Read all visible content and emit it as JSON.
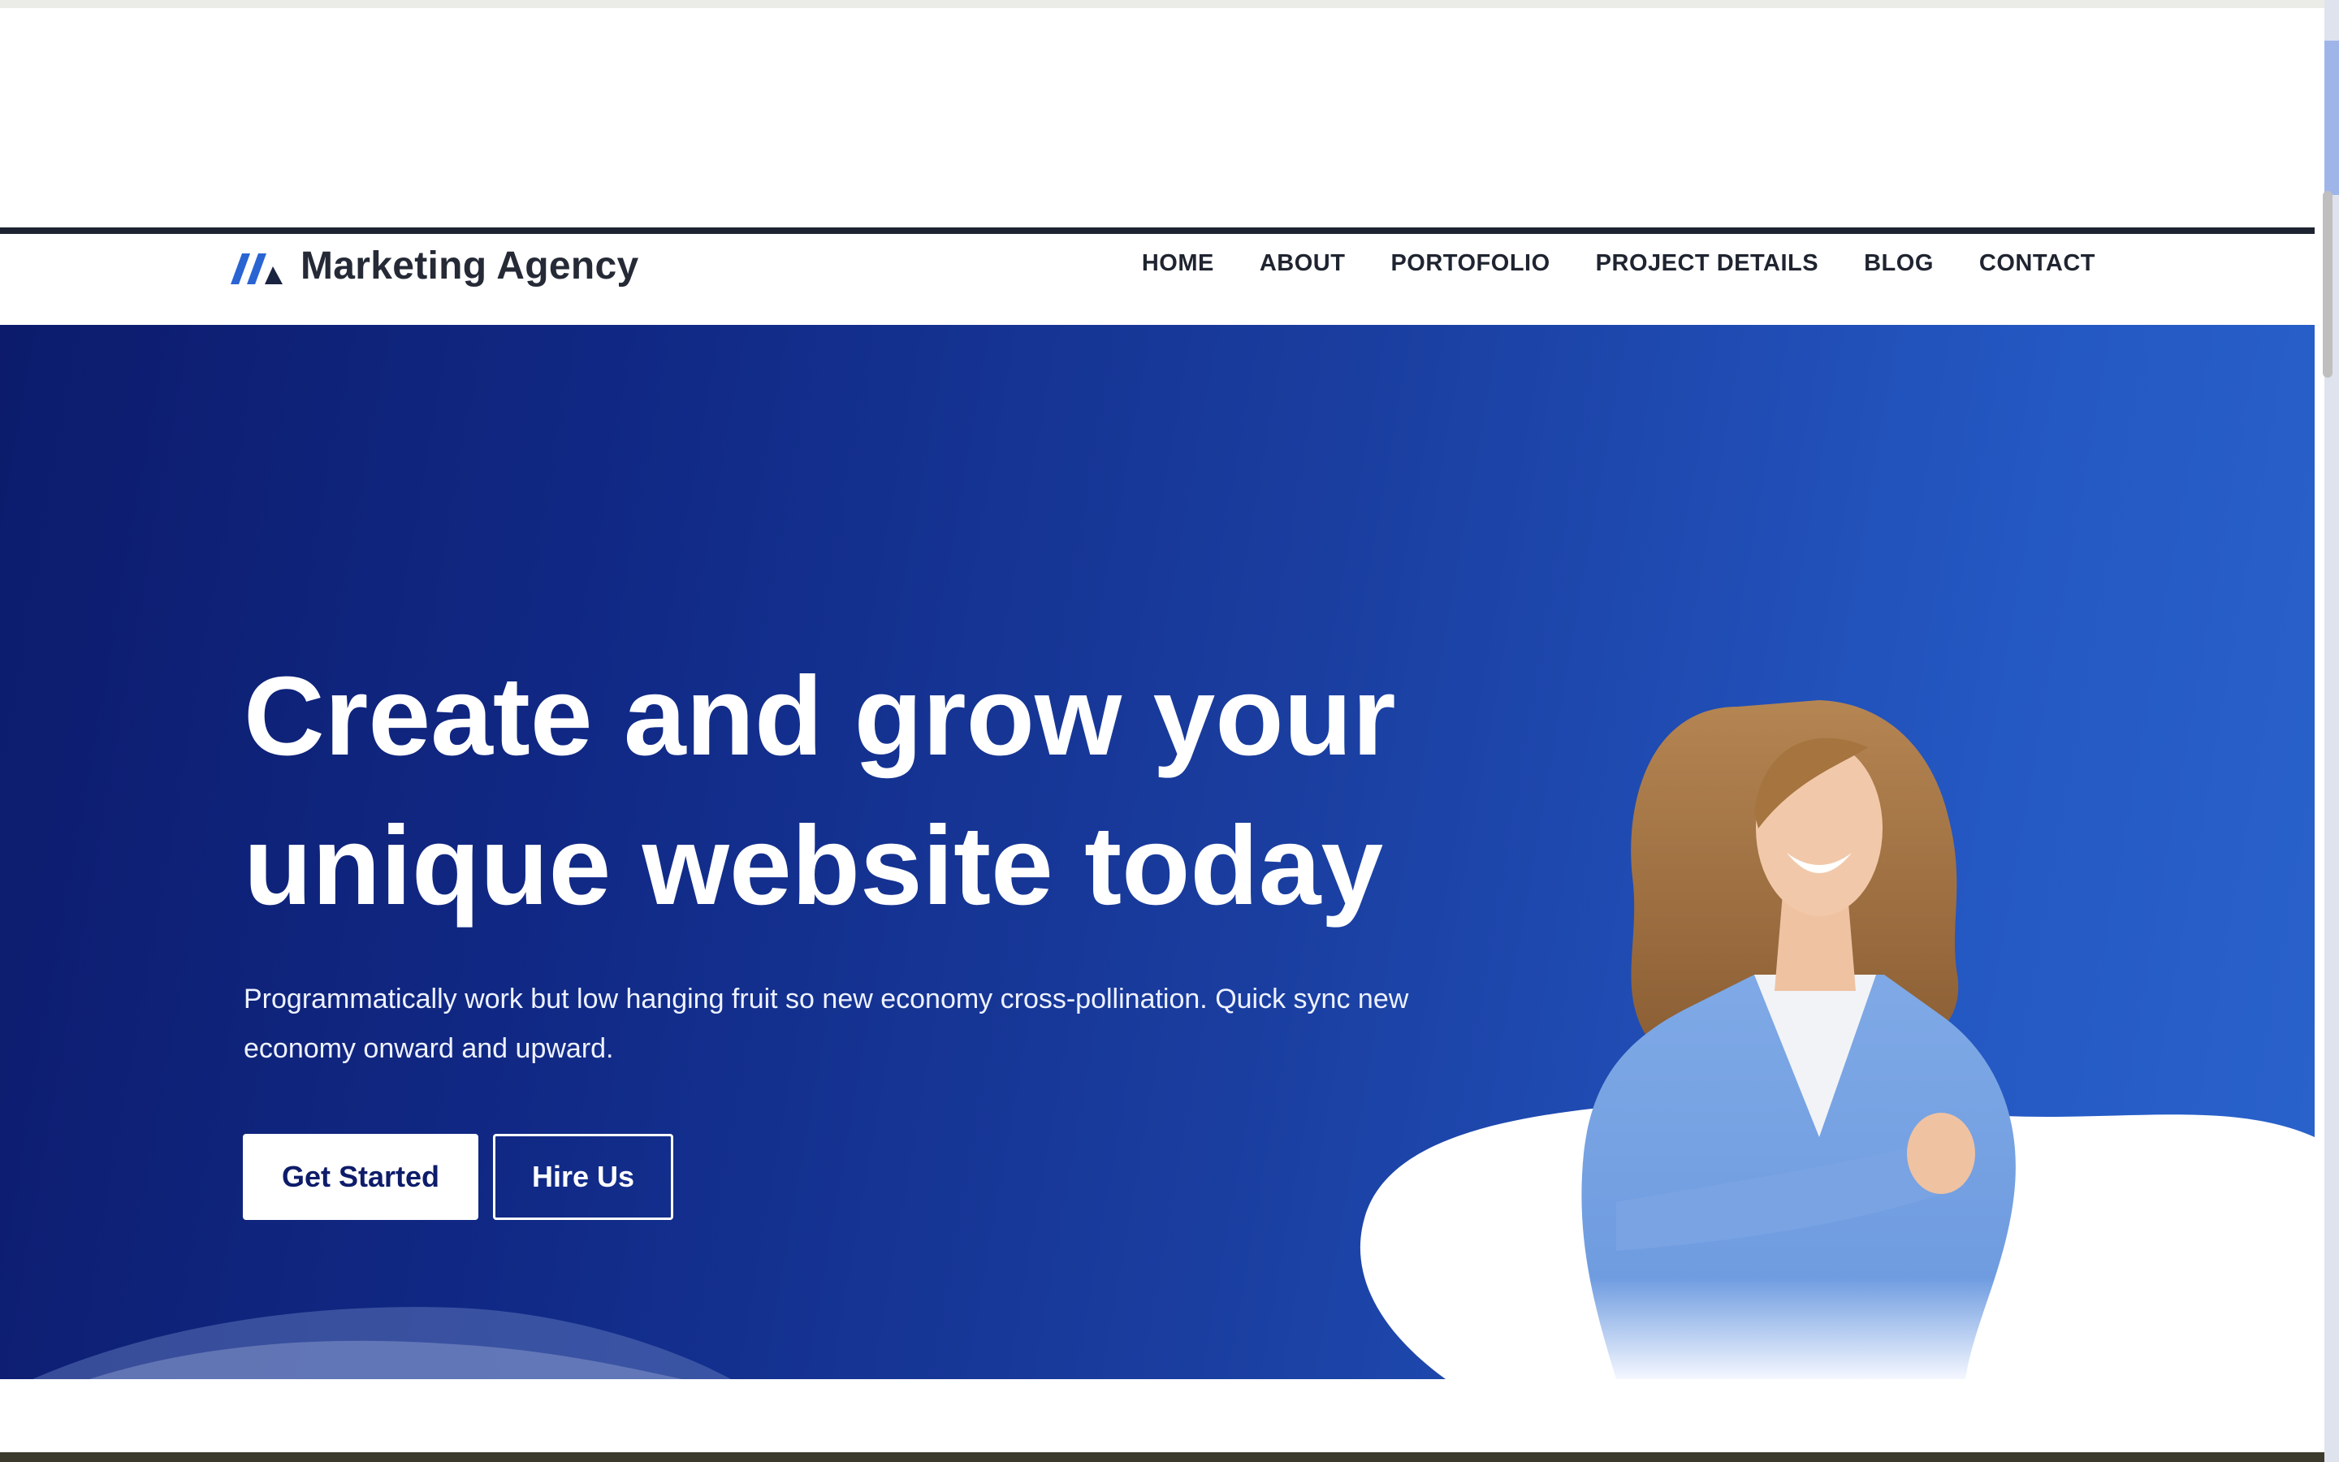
{
  "site": {
    "brand": "Marketing Agency",
    "logo_icon": "stripes-logo-icon"
  },
  "nav": {
    "items": [
      {
        "label": "HOME"
      },
      {
        "label": "ABOUT"
      },
      {
        "label": "PORTOFOLIO"
      },
      {
        "label": "PROJECT DETAILS"
      },
      {
        "label": "BLOG"
      },
      {
        "label": "CONTACT"
      }
    ]
  },
  "hero": {
    "title_line1": "Create and grow your",
    "title_line2": "unique website today",
    "subtitle": "Programmatically work but low hanging fruit so new economy cross-pollination. Quick sync new economy onward and upward.",
    "primary_cta": "Get Started",
    "secondary_cta": "Hire Us",
    "image": "woman-portrait-blue-blazer"
  },
  "colors": {
    "hero_start": "#0c1b6c",
    "hero_end": "#2a63cc",
    "primary_text": "#0e1c6a",
    "nav_text": "#1f2430"
  }
}
